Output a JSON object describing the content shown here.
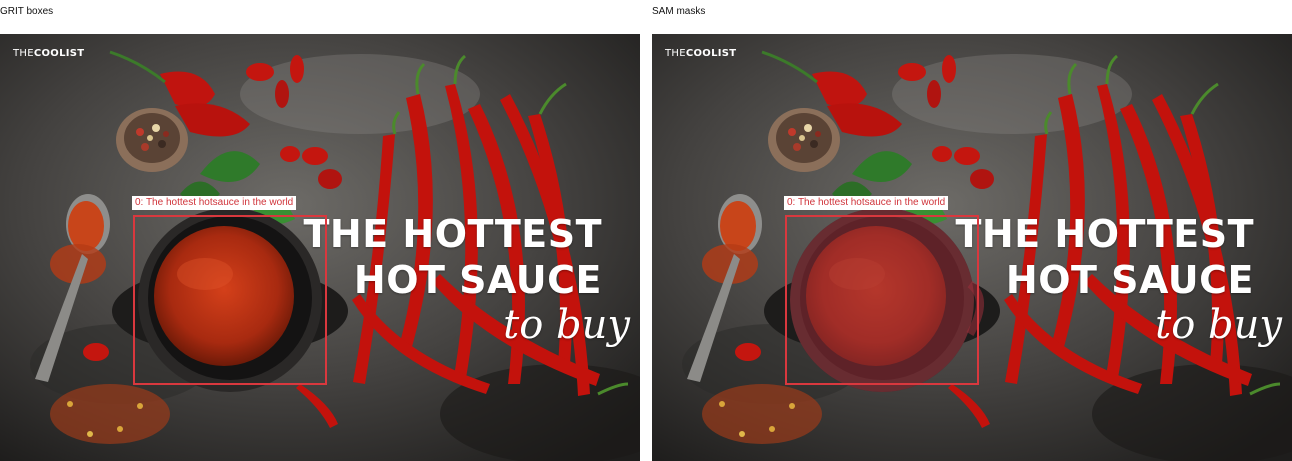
{
  "panels": {
    "left_title": "GRIT boxes",
    "right_title": "SAM masks"
  },
  "image": {
    "brand_prefix": "THE",
    "brand_bold": "COOLIST",
    "headline_line1": "THE HOTTEST",
    "headline_line2": "HOT SAUCE",
    "headline_script": "to buy"
  },
  "detection": {
    "label": "0: The hottest hotsauce in the world",
    "box_color": "#d9383e",
    "mask_color": "#9b2f3a"
  }
}
